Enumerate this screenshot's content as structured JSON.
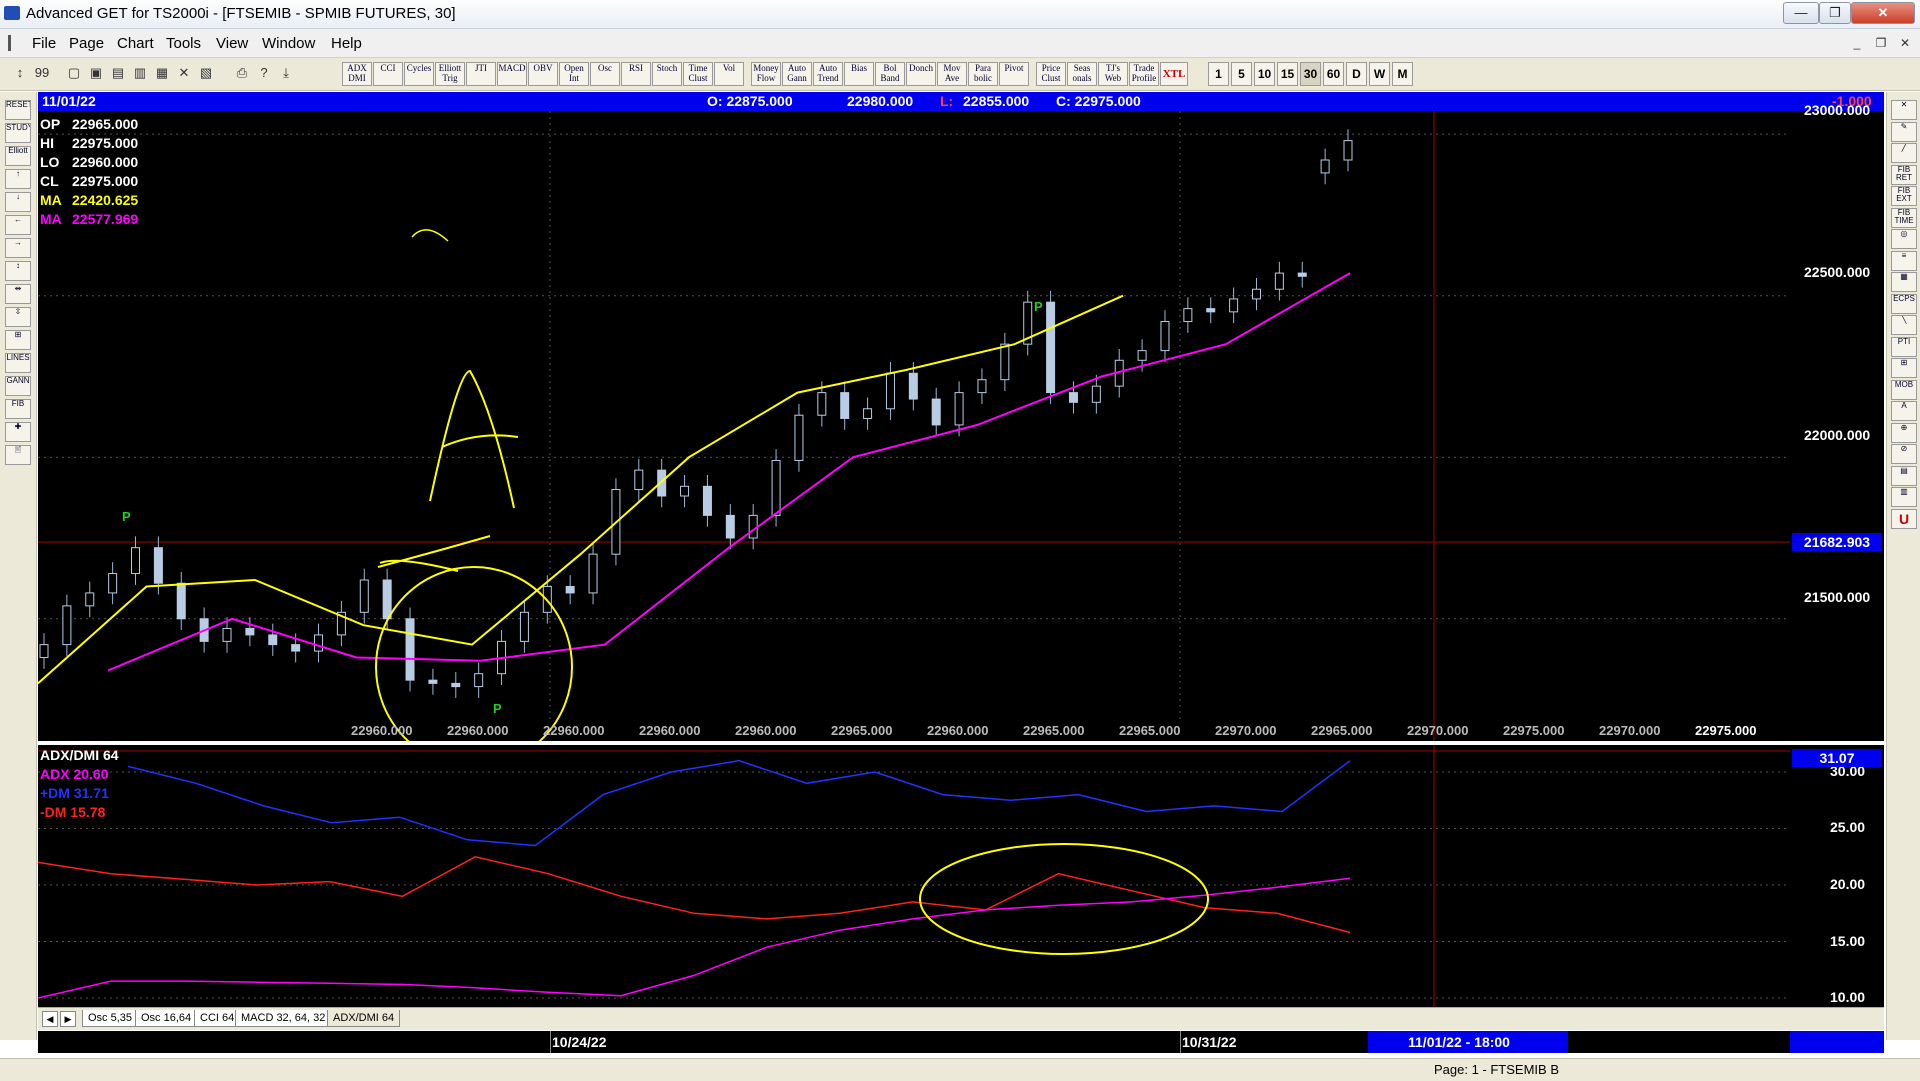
{
  "window": {
    "title": "Advanced GET for TS2000i - [FTSEMIB - SPMIB FUTURES, 30]",
    "btn_min": "—",
    "btn_max": "❐",
    "btn_close": "✕"
  },
  "menu": [
    "File",
    "Page",
    "Chart",
    "Tools",
    "View",
    "Window",
    "Help"
  ],
  "toolbar": {
    "studies": [
      "ADX DMI",
      "CCI",
      "Cycles",
      "Elliott Trig",
      "JTI",
      "MACD",
      "OBV",
      "Open Int",
      "Osc",
      "RSI",
      "Stoch",
      "Time Clust",
      "Vol",
      "Money Flow",
      "Auto Gann",
      "Auto Trend",
      "Bias",
      "Bol Band",
      "Donch",
      "Mov Ave",
      "Para bolic",
      "Pivot",
      "Price Clust",
      "Seas onals",
      "TJ's Web",
      "Trade Profile",
      "XTL"
    ],
    "timeframes": [
      "1",
      "5",
      "10",
      "15",
      "30",
      "60",
      "D",
      "W",
      "M"
    ]
  },
  "left_tools": [
    "RESET",
    "STUDY",
    "Elliott",
    "↑",
    "↓",
    "←",
    "→",
    "↕",
    "⇹",
    "⇳",
    "⊞",
    "LINES",
    "GANN",
    "FIB",
    "✚",
    "🖹"
  ],
  "right_tools": [
    "✕",
    "✎",
    "╱",
    "FIB RET",
    "FIB EXT",
    "FIB TIME",
    "◎",
    "≡",
    "▦",
    "ECPS",
    "╲",
    "PTI",
    "⊞",
    "MOB",
    "A",
    "⊕",
    "⊘",
    "▤",
    "▥",
    "U"
  ],
  "header": {
    "date": "11/01/22",
    "o": "O: 22875.000",
    "h": "22980.000",
    "l_prefix": "L:",
    "l": "22855.000",
    "c": "C: 22975.000",
    "change": "-1.000"
  },
  "price_panel": {
    "readout": [
      {
        "label": "OP",
        "value": "22965.000",
        "color": "#ffffff"
      },
      {
        "label": "HI",
        "value": "22975.000",
        "color": "#ffffff"
      },
      {
        "label": "LO",
        "value": "22960.000",
        "color": "#ffffff"
      },
      {
        "label": "CL",
        "value": "22975.000",
        "color": "#ffffff"
      },
      {
        "label": "MA",
        "value": "22420.625",
        "color": "#ffff00"
      },
      {
        "label": "MA",
        "value": "22577.969",
        "color": "#ff00ff"
      }
    ],
    "y_labels": [
      "23000.000",
      "22500.000",
      "22000.000",
      "21500.000"
    ],
    "cursor_price": "21682.903",
    "bottom_values": [
      "22960.000",
      "22960.000",
      "22960.000",
      "22960.000",
      "22960.000",
      "22965.000",
      "22960.000",
      "22965.000",
      "22965.000",
      "22970.000",
      "22965.000",
      "22970.000",
      "22975.000",
      "22970.000",
      "22975.000"
    ],
    "pivot_label": "P"
  },
  "indicator_panel": {
    "title": "ADX/DMI 64",
    "lines": [
      {
        "label": "ADX 20.60",
        "color": "#ff00ff"
      },
      {
        "label": "+DM 31.71",
        "color": "#2233ff"
      },
      {
        "label": "-DM  15.78",
        "color": "#ff2020"
      }
    ],
    "y_labels": [
      "30.00",
      "25.00",
      "20.00",
      "15.00",
      "10.00"
    ],
    "current": "31.07"
  },
  "tabs": [
    "Osc 5,35",
    "Osc 16,64",
    "CCI 64",
    "MACD 32, 64, 32",
    "ADX/DMI 64"
  ],
  "time_axis": {
    "labels": [
      "10/24/22",
      "10/31/22"
    ],
    "cursor": "11/01/22 - 18:00"
  },
  "status": {
    "page": "Page: 1 - FTSEMIB B"
  },
  "colors": {
    "header": "#0000ee",
    "ma_fast": "#ffff00",
    "ma_slow": "#ff00ff",
    "pdm": "#2233ff",
    "mdm": "#ff2020",
    "adx": "#ff00ff",
    "pivot": "#22cc22",
    "annotation": "#ffff00",
    "crosshair": "#aa0000"
  },
  "chart_data": {
    "type": "line",
    "title": "",
    "xlabel": "",
    "ylabel": "",
    "ylim": [
      21100,
      23050
    ],
    "x": [
      "10/24/22",
      "10/31/22",
      "11/01/22"
    ],
    "series": [
      {
        "values": [
          21300,
          21600,
          21620,
          21480,
          21420,
          21700,
          22000,
          22200,
          22270,
          22350,
          22500
        ]
      },
      {
        "values": [
          21340,
          21500,
          21380,
          21370,
          21420,
          21720,
          22000,
          22100,
          22250,
          22350,
          22570
        ]
      }
    ],
    "closes": [
      21420,
      21540,
      21580,
      21640,
      21720,
      21610,
      21500,
      21430,
      21470,
      21450,
      21420,
      21400,
      21450,
      21520,
      21620,
      21500,
      21310,
      21300,
      21290,
      21330,
      21430,
      21520,
      21600,
      21580,
      21700,
      21900,
      21960,
      21880,
      21910,
      21820,
      21750,
      21820,
      21990,
      22130,
      22200,
      22120,
      22150,
      22260,
      22180,
      22100,
      22200,
      22240,
      22350,
      22480,
      22200,
      22170,
      22220,
      22300,
      22330,
      22420,
      22460,
      22450,
      22490,
      22520,
      22570,
      22560,
      22920,
      22980
    ],
    "adx": [
      10,
      11.5,
      11.5,
      11.4,
      11.3,
      11.2,
      10.9,
      10.5,
      10.2,
      12,
      14.5,
      16,
      17,
      17.8,
      18.2,
      18.5,
      19.1,
      19.8,
      20.6
    ],
    "pdm": [
      30.5,
      29,
      27,
      25.5,
      26,
      24,
      23.5,
      28,
      30,
      31,
      29,
      30,
      28,
      27.5,
      28,
      26.5,
      27,
      26.5,
      31
    ],
    "mdm": [
      22,
      21,
      20.5,
      20,
      20.3,
      19,
      22.5,
      21,
      19,
      17.5,
      17,
      17.5,
      18.5,
      17.8,
      21,
      19.5,
      18,
      17.5,
      15.8
    ]
  }
}
